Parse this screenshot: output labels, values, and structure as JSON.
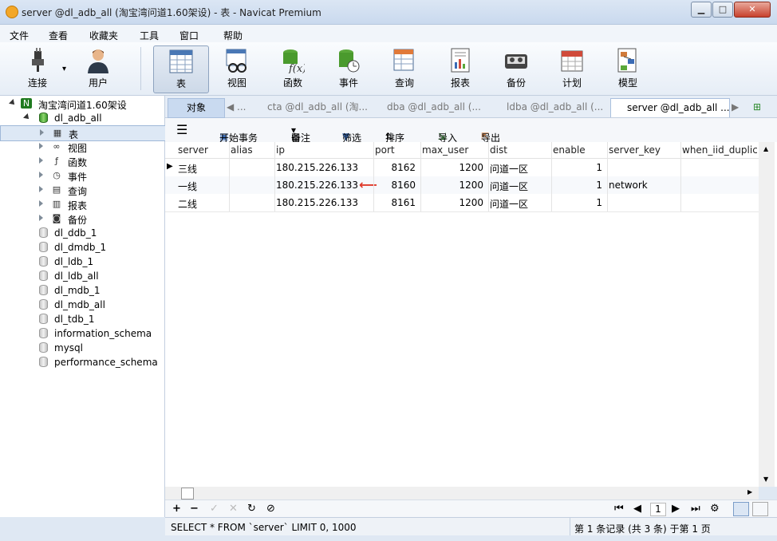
{
  "window": {
    "title": "server @dl_adb_all (淘宝湾问道1.60架设) - 表 - Navicat Premium",
    "min": "▁",
    "max": "□",
    "close": "✕"
  },
  "menu": [
    "文件",
    "查看",
    "收藏夹",
    "工具",
    "窗口",
    "帮助"
  ],
  "toolbar": {
    "connect": "连接",
    "user": "用户",
    "table": "表",
    "view": "视图",
    "function": "函数",
    "event": "事件",
    "query": "查询",
    "report": "报表",
    "backup": "备份",
    "schedule": "计划",
    "model": "模型",
    "connect_arrow": "▾"
  },
  "sidebar": {
    "connection": "淘宝湾问道1.60架设",
    "active_db": "dl_adb_all",
    "objects": [
      "表",
      "视图",
      "函数",
      "事件",
      "查询",
      "报表",
      "备份"
    ],
    "object_icons": [
      "table-icon",
      "view-icon",
      "function-icon",
      "event-icon",
      "query-icon",
      "report-icon",
      "backup-icon"
    ],
    "databases": [
      "dl_ddb_1",
      "dl_dmdb_1",
      "dl_ldb_1",
      "dl_ldb_all",
      "dl_mdb_1",
      "dl_mdb_all",
      "dl_tdb_1",
      "information_schema",
      "mysql",
      "performance_schema"
    ]
  },
  "tabs": {
    "object": "对象",
    "back": "◀ ...",
    "items": [
      "cta @dl_adb_all (淘...",
      "dba @dl_adb_all (...",
      "ldba @dl_adb_all (...",
      "server @dl_adb_all ..."
    ],
    "more": "▶"
  },
  "subtoolbar": {
    "menu": "☰",
    "begin_txn": "开始事务",
    "memo": "备注",
    "filter": "筛选",
    "sort": "排序",
    "import": "导入",
    "export": "导出"
  },
  "grid": {
    "columns": [
      "server",
      "alias",
      "ip",
      "port",
      "max_user",
      "dist",
      "enable",
      "server_key",
      "when_iid_duplica"
    ],
    "rows": [
      [
        "三线",
        "",
        "180.215.226.133",
        "8162",
        "1200",
        "问道一区",
        "1",
        "",
        ""
      ],
      [
        "一线",
        "",
        "180.215.226.133",
        "8160",
        "1200",
        "问道一区",
        "1",
        "network",
        ""
      ],
      [
        "二线",
        "",
        "180.215.226.133",
        "8161",
        "1200",
        "问道一区",
        "1",
        "",
        ""
      ]
    ],
    "current_row_marker": "▶",
    "annotation_arrow": "⟵"
  },
  "navbar": {
    "add": "+",
    "delete": "−",
    "apply": "✓",
    "discard": "✕",
    "refresh": "↻",
    "stop": "⊘",
    "first": "⏮",
    "prev": "◀",
    "page": "1",
    "next": "▶",
    "last": "⏭",
    "settings": "⚙"
  },
  "status": {
    "sql": "SELECT * FROM `server` LIMIT 0, 1000",
    "records": "第 1 条记录 (共 3 条) 于第 1 页"
  }
}
